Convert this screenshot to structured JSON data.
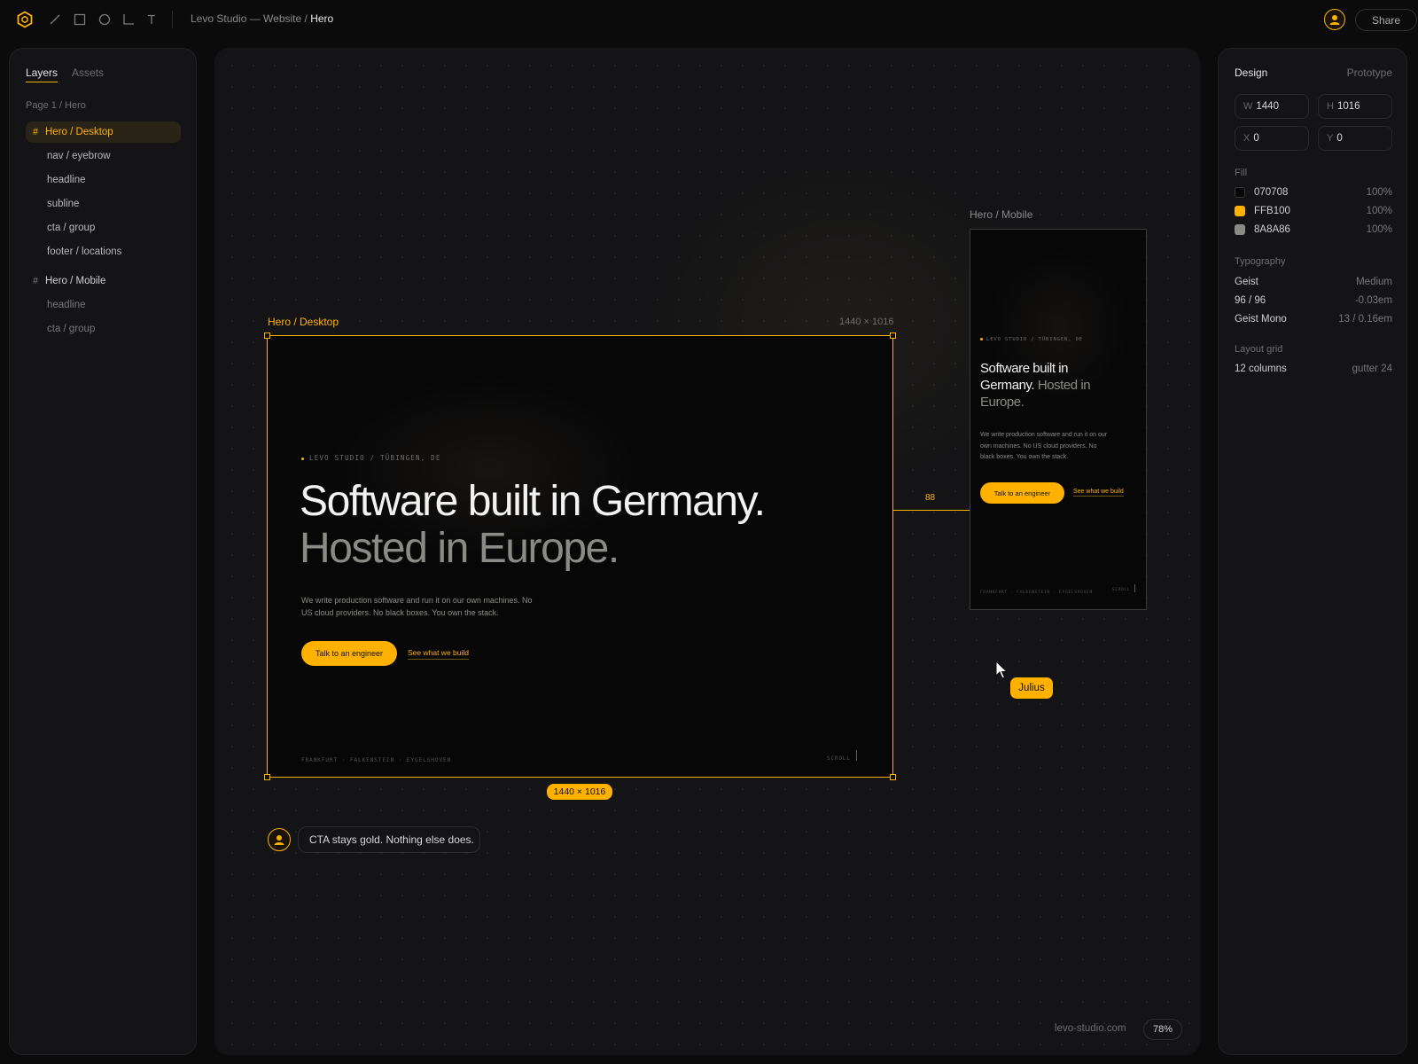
{
  "header": {
    "project": "Levo Studio — Website / ",
    "current_page": "Hero",
    "share_label": "Share"
  },
  "colors": {
    "accent": "#FFB100",
    "bg": "#070708",
    "muted": "#8A8A86"
  },
  "icons": [
    "logo-icon",
    "line-tool-icon",
    "rectangle-tool-icon",
    "ellipse-tool-icon",
    "frame-tool-icon",
    "text-tool-icon",
    "user-avatar-icon",
    "cursor-icon"
  ],
  "layers_panel": {
    "tab_layers": "Layers",
    "tab_assets": "Assets",
    "page": "Page 1 / Hero",
    "items": [
      {
        "label": "Hero / Desktop",
        "kind": "frame",
        "selected": true
      },
      {
        "label": "nav / eyebrow",
        "kind": "child"
      },
      {
        "label": "headline",
        "kind": "child"
      },
      {
        "label": "subline",
        "kind": "child"
      },
      {
        "label": "cta / group",
        "kind": "child"
      },
      {
        "label": "footer / locations",
        "kind": "child"
      },
      {
        "label": "Hero / Mobile",
        "kind": "frame"
      },
      {
        "label": "headline",
        "kind": "child"
      },
      {
        "label": "cta / group",
        "kind": "child"
      }
    ]
  },
  "design_panel": {
    "tab_design": "Design",
    "tab_prototype": "Prototype",
    "w_key": "W",
    "w": "1440",
    "h_key": "H",
    "h": "1016",
    "x_key": "X",
    "x": "0",
    "y_key": "Y",
    "y": "0",
    "fill_label": "Fill",
    "fills": [
      {
        "hex": "070708",
        "opacity": "100%",
        "color": "#070708"
      },
      {
        "hex": "FFB100",
        "opacity": "100%",
        "color": "#FFB100"
      },
      {
        "hex": "8A8A86",
        "opacity": "100%",
        "color": "#8A8A86"
      }
    ],
    "typography_label": "Typography",
    "typography": [
      {
        "name": "Geist",
        "value": "Medium"
      },
      {
        "name": "96 / 96",
        "value": "-0.03em"
      },
      {
        "name": "Geist Mono",
        "value": "13 / 0.16em"
      }
    ],
    "grid_label": "Layout grid",
    "grid": {
      "name": "12 columns",
      "value": "gutter 24"
    }
  },
  "canvas": {
    "desktop_label": "Hero / Desktop",
    "desktop_size": "1440 × 1016",
    "desktop_badge": "1440 × 1016",
    "mobile_label": "Hero / Mobile",
    "gap_measure": "88",
    "cursor_user": "Julius",
    "comment": "CTA stays gold. Nothing else does.",
    "site": "levo-studio.com",
    "zoom": "78%"
  },
  "hero": {
    "eyebrow": "LEVO STUDIO / TÜBINGEN, DE",
    "headline_1": "Software built in Germany.",
    "headline_2": "Hosted in Europe.",
    "mobile_headline_1a": "Software built in",
    "mobile_headline_1b": "Germany.",
    "mobile_headline_2a": "Hosted in",
    "mobile_headline_2b": "Europe.",
    "sub_1": "We write production software and run it on our own machines. No",
    "sub_2": "US cloud providers. No black boxes. You own the stack.",
    "mobile_sub_1": "We write production software and run it on our",
    "mobile_sub_2": "own machines. No US cloud providers. No",
    "mobile_sub_3": "black boxes. You own the stack.",
    "cta": "Talk to an engineer",
    "link": "See what we build",
    "locations": "FRANKFURT · FALKENSTEIN · EYGELSHOVEN",
    "scroll": "SCROLL"
  }
}
